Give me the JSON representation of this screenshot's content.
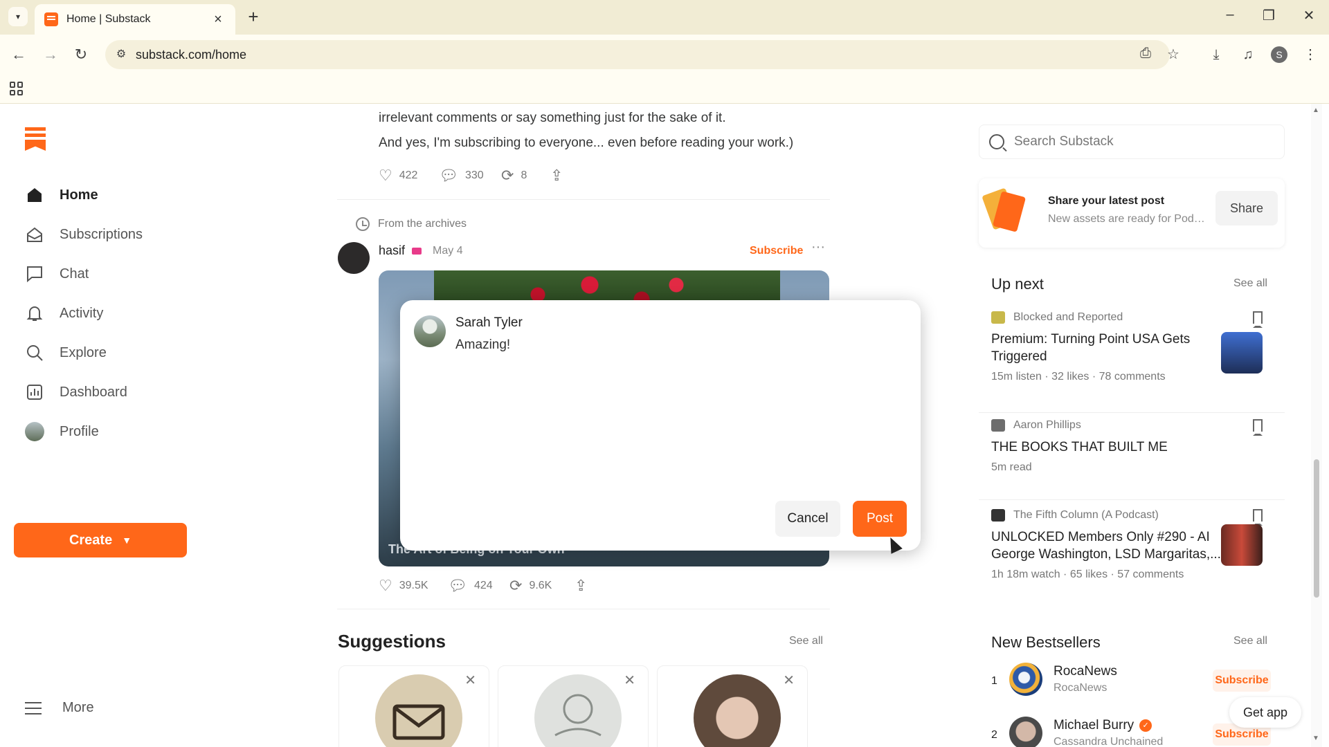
{
  "browser": {
    "tab_title": "Home | Substack",
    "url": "substack.com/home",
    "profile_initial": "S"
  },
  "nav": {
    "items": [
      {
        "label": "Home",
        "icon": "home-icon"
      },
      {
        "label": "Subscriptions",
        "icon": "subscriptions-icon"
      },
      {
        "label": "Chat",
        "icon": "chat-icon"
      },
      {
        "label": "Activity",
        "icon": "bell-icon"
      },
      {
        "label": "Explore",
        "icon": "search-icon"
      },
      {
        "label": "Dashboard",
        "icon": "dashboard-icon"
      },
      {
        "label": "Profile",
        "icon": "profile-avatar"
      }
    ],
    "create_label": "Create",
    "more_label": "More"
  },
  "feed": {
    "prev_post": {
      "line1": "irrelevant comments or say something just for the sake of it.",
      "line2": "And yes, I'm subscribing to everyone... even before reading your work.)",
      "likes": "422",
      "comments": "330",
      "restacks": "8"
    },
    "archive_label": "From the archives",
    "post": {
      "author": "hasif",
      "date": "May 4",
      "subscribe_label": "Subscribe",
      "caption": "The Art of Being on Your Own",
      "likes": "39.5K",
      "comments": "424",
      "restacks": "9.6K"
    },
    "suggestions_title": "Suggestions",
    "suggestions_see_all": "See all"
  },
  "rail": {
    "search_placeholder": "Search Substack",
    "share_card": {
      "title": "Share your latest post",
      "subtitle": "New assets are ready for Podc...",
      "button": "Share"
    },
    "up_next": {
      "title": "Up next",
      "see_all": "See all",
      "items": [
        {
          "publication": "Blocked and Reported",
          "title": "Premium: Turning Point USA Gets Triggered",
          "meta": "15m listen · 32 likes · 78 comments"
        },
        {
          "publication": "Aaron Phillips",
          "title": "THE BOOKS THAT BUILT ME",
          "meta": "5m read"
        },
        {
          "publication": "The Fifth Column (A Podcast)",
          "title": "UNLOCKED Members Only #290 - AI George Washington, LSD Margaritas,...",
          "meta": "1h 18m watch · 65 likes · 57 comments"
        }
      ]
    },
    "bestsellers": {
      "title": "New Bestsellers",
      "see_all": "See all",
      "items": [
        {
          "rank": "1",
          "name": "RocaNews",
          "sub": "RocaNews",
          "button": "Subscribe"
        },
        {
          "rank": "2",
          "name": "Michael Burry",
          "sub": "Cassandra Unchained",
          "button": "Subscribe"
        }
      ]
    },
    "get_app": "Get app"
  },
  "dialog": {
    "user_name": "Sarah Tyler",
    "comment_text": "Amazing!",
    "cancel_label": "Cancel",
    "post_label": "Post"
  },
  "colors": {
    "accent": "#ff6719",
    "chrome": "#f1ecd4"
  }
}
